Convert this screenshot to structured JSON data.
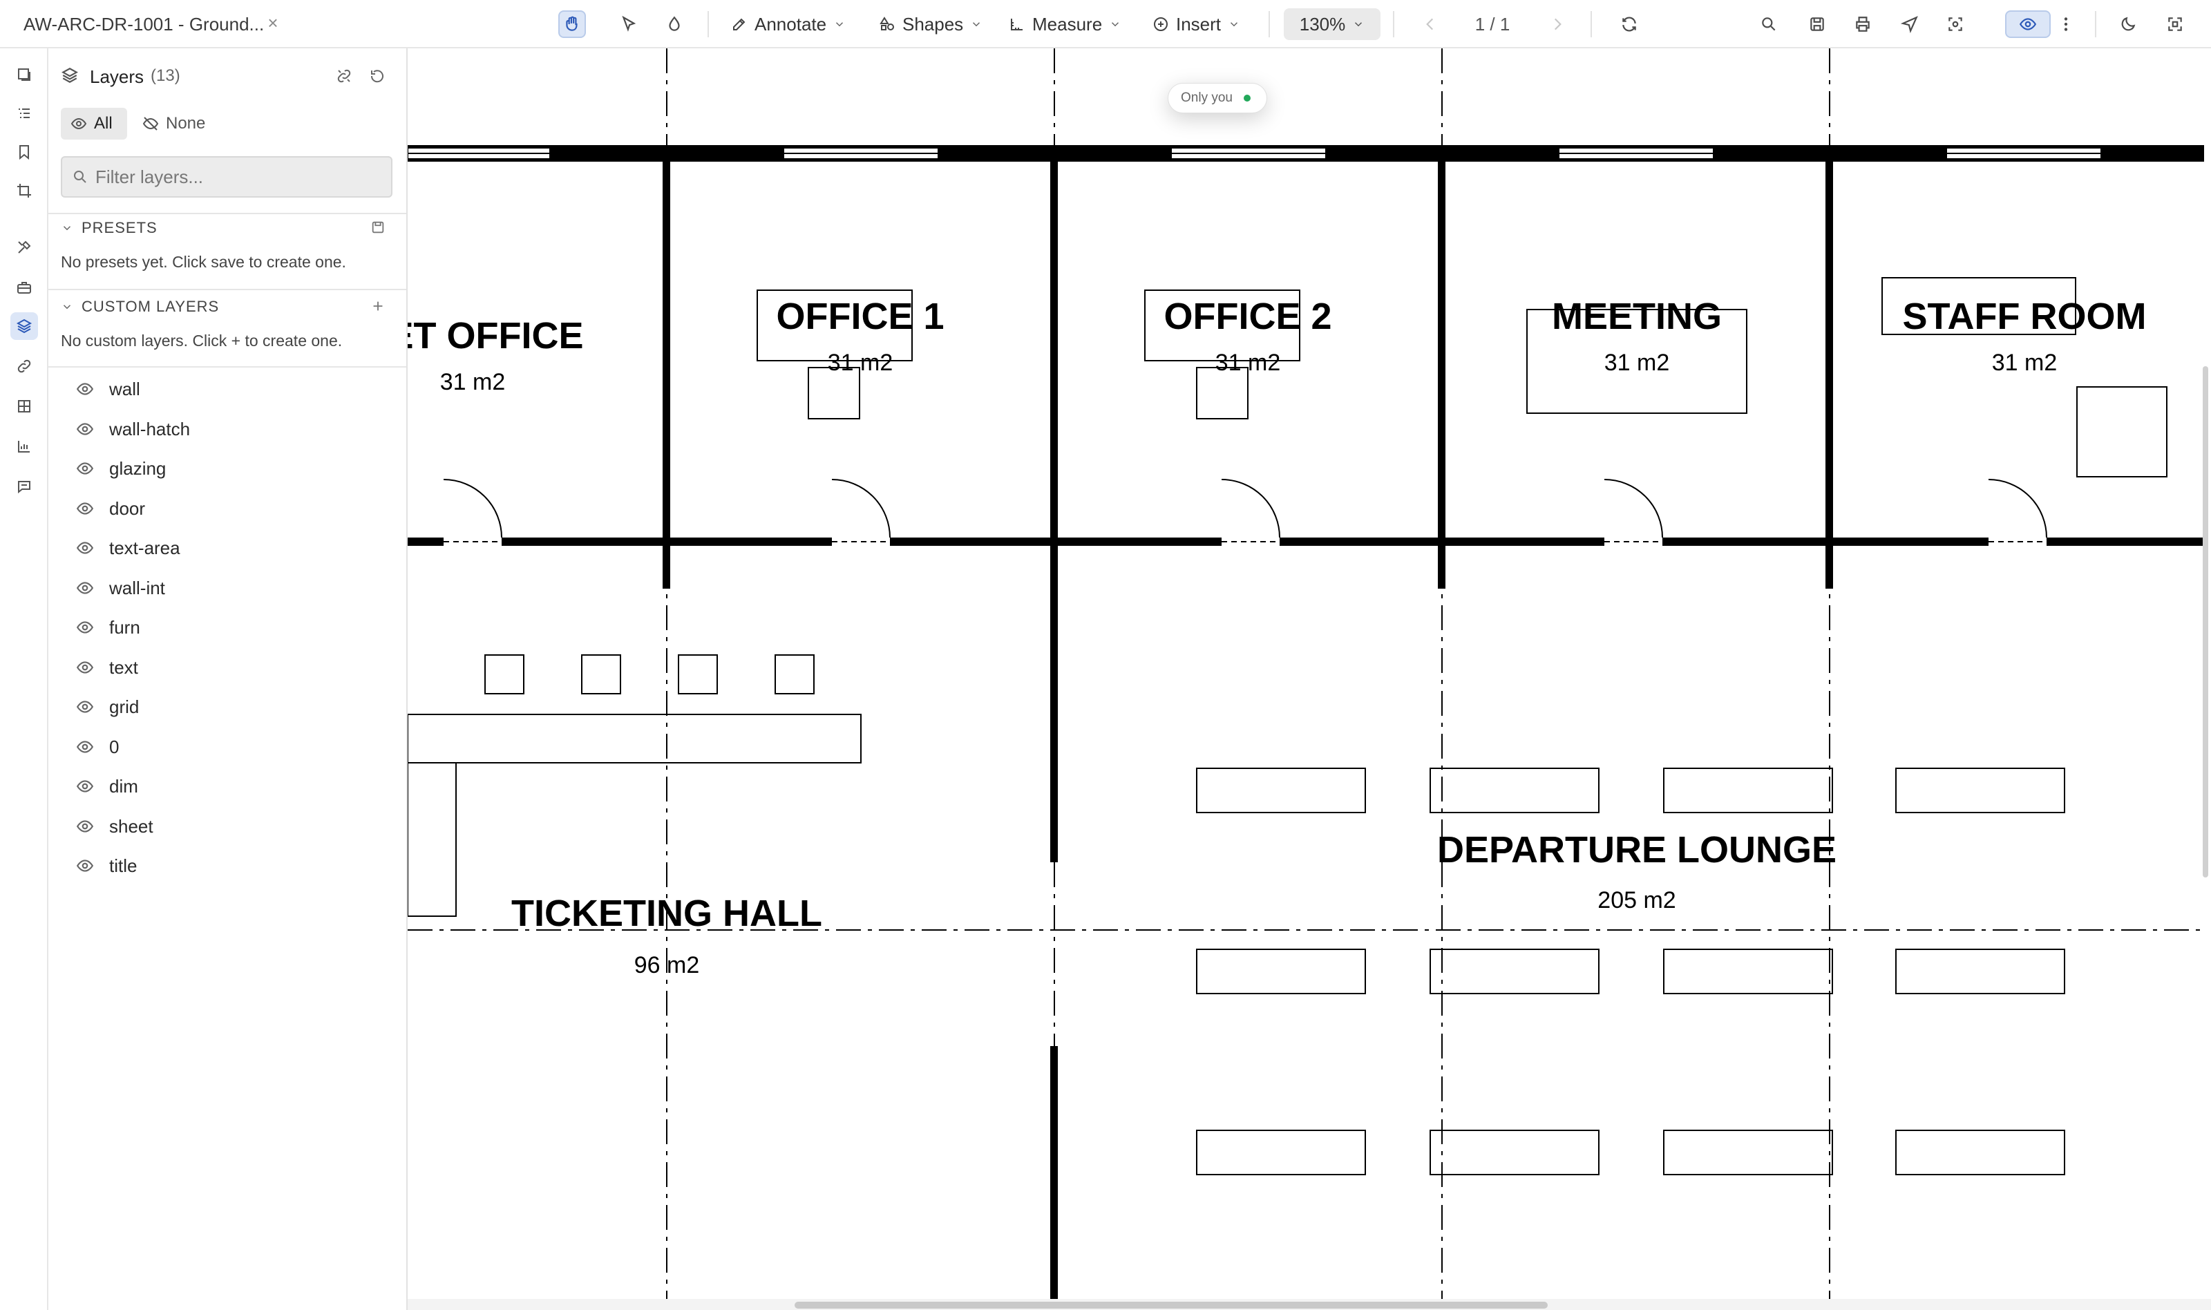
{
  "toolbar": {
    "doc_title": "AW-ARC-DR-1001 - Ground...",
    "close_glyph": "×",
    "annotate_label": "Annotate",
    "shapes_label": "Shapes",
    "measure_label": "Measure",
    "insert_label": "Insert",
    "zoom_label": "130%",
    "page_indicator": "1 / 1",
    "icons": [
      "hand-icon",
      "select-arrow-icon",
      "ink-drop-icon",
      "pencil-icon",
      "shapes-icon",
      "ruler-icon",
      "plus-circle-icon",
      "chevron-left-icon",
      "chevron-right-icon",
      "refresh-icon",
      "search-icon",
      "save-icon",
      "print-icon",
      "send-icon",
      "scan-icon",
      "eye-icon",
      "more-vertical-icon",
      "moon-icon",
      "expand-icon"
    ]
  },
  "rail": {
    "icons": [
      "thumbnails-icon",
      "outline-icon",
      "bookmark-icon",
      "crop-icon",
      "tools-icon",
      "briefcase-icon",
      "layers-icon",
      "link-icon",
      "table-icon",
      "measure-icon",
      "comment-icon"
    ],
    "active": "layers-icon"
  },
  "panel": {
    "title": "Layers",
    "count": "(13)",
    "all_label": "All",
    "none_label": "None",
    "filter_placeholder": "Filter layers...",
    "presets_header": "PRESETS",
    "presets_empty": "No presets yet. Click save to create one.",
    "custom_header": "CUSTOM LAYERS",
    "custom_empty": "No custom layers. Click + to create one.",
    "layers": [
      "wall",
      "wall-hatch",
      "glazing",
      "door",
      "text-area",
      "wall-int",
      "furn",
      "text",
      "grid",
      "0",
      "dim",
      "sheet",
      "title"
    ]
  },
  "canvas": {
    "presence_label": "Only you",
    "presence_color": "#22a85a",
    "rooms": [
      {
        "name": "KET OFFICE",
        "area": "31 m2"
      },
      {
        "name": "OFFICE 1",
        "area": "31 m2"
      },
      {
        "name": "OFFICE 2",
        "area": "31 m2"
      },
      {
        "name": "MEETING",
        "area": "31 m2"
      },
      {
        "name": "STAFF ROOM",
        "area": "31 m2"
      },
      {
        "name": "TICKETING HALL",
        "area": "96 m2"
      },
      {
        "name": "DEPARTURE LOUNGE",
        "area": "205 m2"
      }
    ]
  },
  "colors": {
    "accent": "#2c59b8",
    "accent_bg": "#dce6f7"
  }
}
